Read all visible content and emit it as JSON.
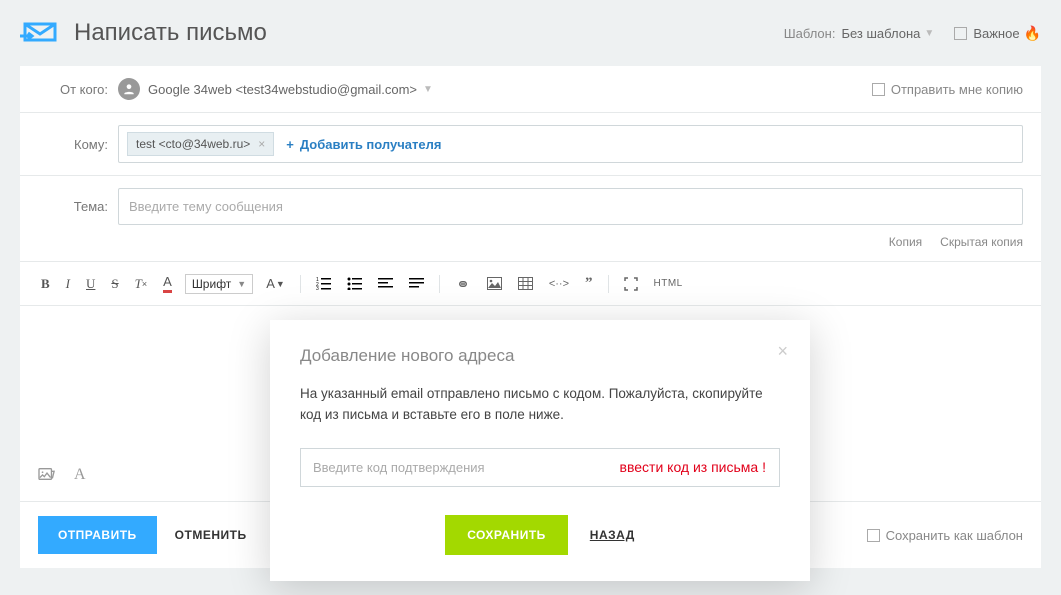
{
  "header": {
    "title": "Написать письмо",
    "template_label": "Шаблон:",
    "template_value": "Без шаблона",
    "important_label": "Важное"
  },
  "from": {
    "label": "От кого:",
    "value": "Google 34web <test34webstudio@gmail.com>",
    "send_me_copy": "Отправить мне копию"
  },
  "to": {
    "label": "Кому:",
    "chip": "test <cto@34web.ru>",
    "add_recipient": "Добавить получателя"
  },
  "subject": {
    "label": "Тема:",
    "placeholder": "Введите тему сообщения"
  },
  "extras": {
    "cc": "Копия",
    "bcc": "Скрытая копия"
  },
  "toolbar": {
    "font_select": "Шрифт",
    "html_label": "HTML"
  },
  "footer": {
    "send": "ОТПРАВИТЬ",
    "cancel": "ОТМЕНИТЬ",
    "save_template": "Сохранить как шаблон"
  },
  "modal": {
    "title": "Добавление нового адреса",
    "message": "На указанный email отправлено письмо с кодом. Пожалуйста, скопируйте код из письма и вставьте его в поле ниже.",
    "placeholder": "Введите код подтверждения",
    "hint": "ввести код из письма !",
    "save": "СОХРАНИТЬ",
    "back": "НАЗАД"
  }
}
